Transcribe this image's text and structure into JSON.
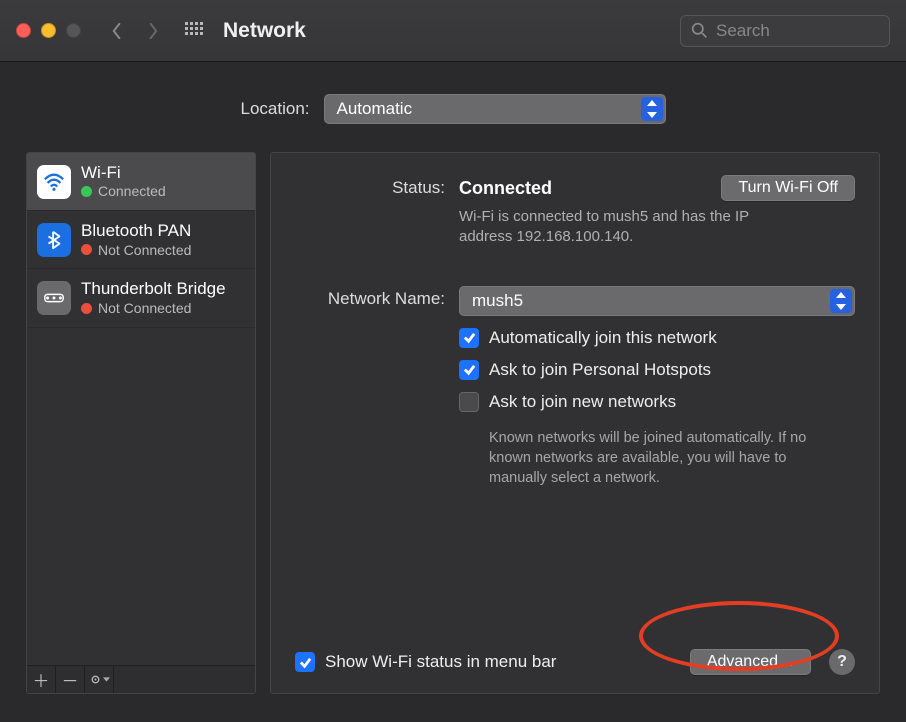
{
  "window": {
    "title": "Network",
    "search_placeholder": "Search"
  },
  "location": {
    "label": "Location:",
    "value": "Automatic"
  },
  "services": [
    {
      "name": "Wi-Fi",
      "status": "Connected",
      "color": "green",
      "icon": "wifi",
      "active": true
    },
    {
      "name": "Bluetooth PAN",
      "status": "Not Connected",
      "color": "red",
      "icon": "bluetooth",
      "active": false
    },
    {
      "name": "Thunderbolt Bridge",
      "status": "Not Connected",
      "color": "red",
      "icon": "tb",
      "active": false
    }
  ],
  "status": {
    "label": "Status:",
    "value": "Connected",
    "toggle_button": "Turn Wi-Fi Off",
    "description": "Wi-Fi is connected to mush5 and has the IP address 192.168.100.140."
  },
  "network_name": {
    "label": "Network Name:",
    "value": "mush5"
  },
  "options": {
    "auto_join": {
      "label": "Automatically join this network",
      "checked": true
    },
    "ask_hotspot": {
      "label": "Ask to join Personal Hotspots",
      "checked": true
    },
    "ask_new": {
      "label": "Ask to join new networks",
      "checked": false,
      "hint": "Known networks will be joined automatically. If no known networks are available, you will have to manually select a network."
    }
  },
  "footer": {
    "menubar_label": "Show Wi-Fi status in menu bar",
    "menubar_checked": true,
    "advanced": "Advanced…",
    "help": "?"
  }
}
